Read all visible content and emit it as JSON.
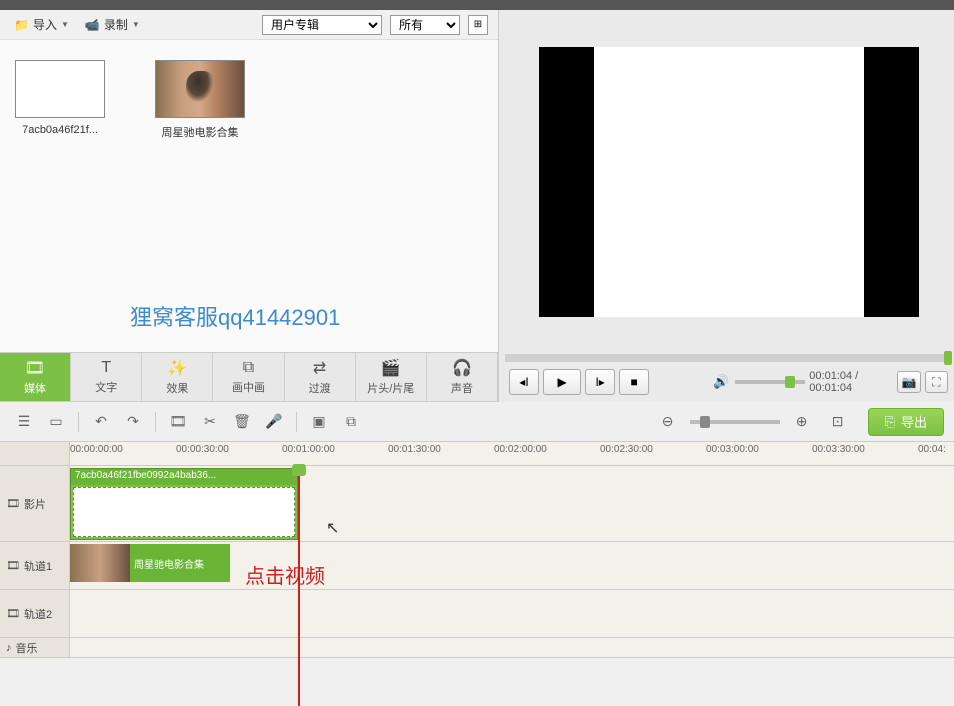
{
  "toolbar": {
    "import": "导入",
    "record": "录制"
  },
  "selects": {
    "album": "用户专辑",
    "filter": "所有"
  },
  "media": {
    "item1": "7acb0a46f21f...",
    "item2": "周星驰电影合集"
  },
  "watermark": "狸窝客服qq41442901",
  "preview": {
    "time": "00:01:04 / 00:01:04"
  },
  "tabs": {
    "media": "媒体",
    "text": "文字",
    "effect": "效果",
    "pip": "画中画",
    "transition": "过渡",
    "intro": "片头/片尾",
    "sound": "声音"
  },
  "export": "导出",
  "ruler": [
    "00:00:00:00",
    "00:00:30:00",
    "00:01:00:00",
    "00:01:30:00",
    "00:02:00:00",
    "00:02:30:00",
    "00:03:00:00",
    "00:03:30:00",
    "00:04:"
  ],
  "tracks": {
    "video": "影片",
    "track1": "轨道1",
    "track2": "轨道2",
    "music": "音乐"
  },
  "clips": {
    "clip1": "7acb0a46f21fbe0992a4bab36...",
    "clip2": "周星驰电影合集"
  },
  "annotation": "点击视频"
}
